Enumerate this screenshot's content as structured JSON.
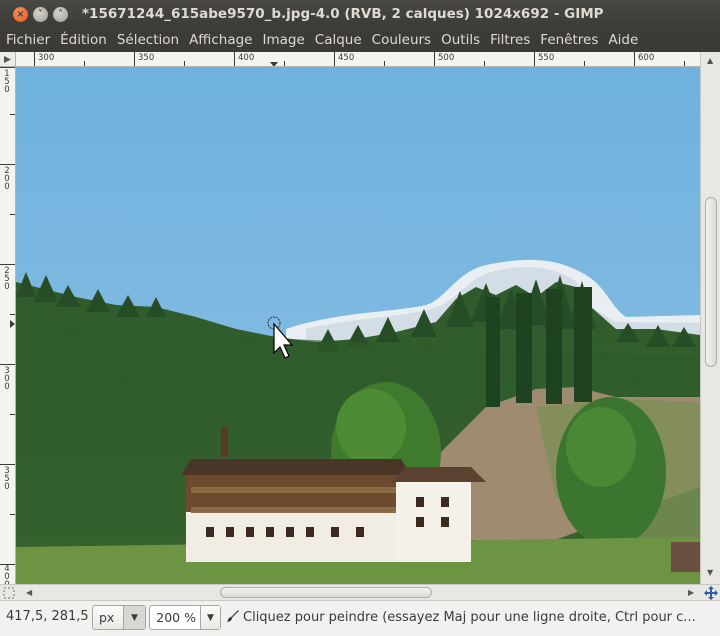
{
  "window": {
    "title": "*15671244_615abe9570_b.jpg-4.0 (RVB, 2 calques) 1024x692 - GIMP"
  },
  "menubar": {
    "items": [
      "Fichier",
      "Édition",
      "Sélection",
      "Affichage",
      "Image",
      "Calque",
      "Couleurs",
      "Outils",
      "Filtres",
      "Fenêtres",
      "Aide"
    ]
  },
  "rulers": {
    "horizontal": [
      "300",
      "350",
      "400",
      "450",
      "500",
      "550",
      "600"
    ],
    "vertical": [
      [
        "1",
        "5",
        "0"
      ],
      [
        "2",
        "0",
        "0"
      ],
      [
        "2",
        "5",
        "0"
      ],
      [
        "3",
        "0",
        "0"
      ],
      [
        "3",
        "5",
        "0"
      ],
      [
        "4",
        "0",
        "0"
      ]
    ]
  },
  "statusbar": {
    "coords": "417,5, 281,5",
    "unit": "px",
    "zoom": "200 %",
    "message": "Cliquez pour peindre (essayez Maj pour une ligne droite, Ctrl pour c..."
  },
  "icons": {
    "close": "close-icon",
    "minimize": "minimize-icon",
    "maximize": "maximize-icon",
    "brush": "paintbrush-icon",
    "navigate": "navigate-icon",
    "quickmask": "quick-mask-icon"
  }
}
